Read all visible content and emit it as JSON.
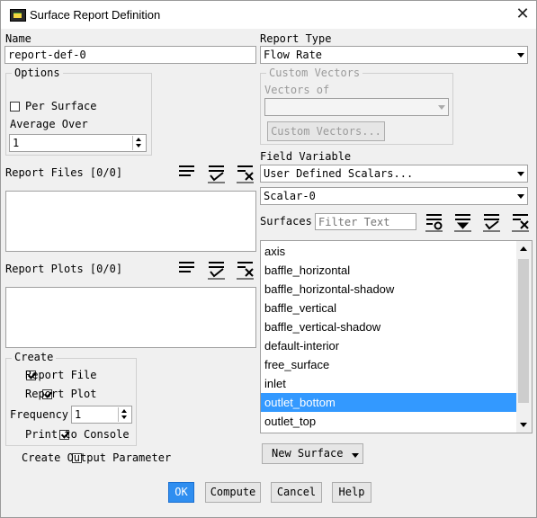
{
  "window": {
    "title": "Surface Report Definition",
    "close_glyph": "✕"
  },
  "name": {
    "label": "Name",
    "value": "report-def-0"
  },
  "report_type": {
    "label": "Report Type",
    "value": "Flow Rate"
  },
  "options": {
    "legend": "Options",
    "per_surface": "Per Surface",
    "per_surface_checked": false,
    "average_over_label": "Average Over",
    "average_over_value": "1"
  },
  "custom_vectors": {
    "legend": "Custom Vectors",
    "vectors_of_label": "Vectors of",
    "vectors_of_value": "",
    "button": "Custom Vectors..."
  },
  "field_variable": {
    "label": "Field Variable",
    "value": "User Defined Scalars...",
    "sub_value": "Scalar-0"
  },
  "report_files": {
    "label": "Report Files [0/0]"
  },
  "report_plots": {
    "label": "Report Plots [0/0]"
  },
  "surfaces": {
    "label": "Surfaces",
    "filter_placeholder": "Filter Text",
    "items": [
      "axis",
      "baffle_horizontal",
      "baffle_horizontal-shadow",
      "baffle_vertical",
      "baffle_vertical-shadow",
      "default-interior",
      "free_surface",
      "inlet",
      "outlet_bottom",
      "outlet_top"
    ],
    "selected": "outlet_bottom"
  },
  "new_surface": {
    "label": "New Surface"
  },
  "create": {
    "legend": "Create",
    "report_file": "Report File",
    "report_file_checked": true,
    "report_plot": "Report Plot",
    "report_plot_checked": true,
    "frequency_label": "Frequency",
    "frequency_value": "1",
    "print_to_console": "Print to Console",
    "print_to_console_checked": true
  },
  "create_output_parameter": {
    "label": "Create Output Parameter",
    "checked": false
  },
  "buttons": {
    "ok": "OK",
    "compute": "Compute",
    "cancel": "Cancel",
    "help": "Help"
  },
  "colors": {
    "selection": "#3399ff",
    "primary_button": "#2f8ef0"
  }
}
